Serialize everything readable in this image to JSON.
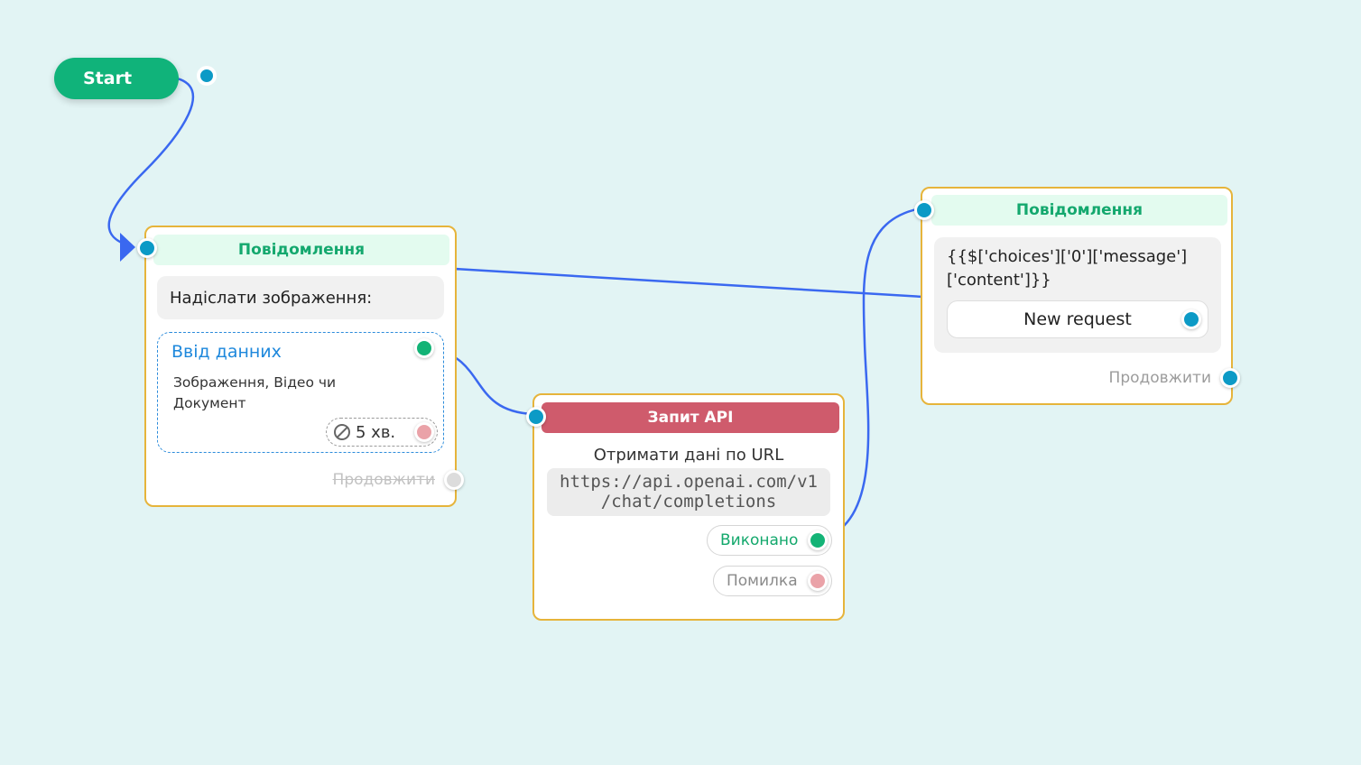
{
  "start": {
    "label": "Start"
  },
  "node_message_1": {
    "header": "Повідомлення",
    "text": "Надіслати зображення:",
    "input": {
      "title": "Ввід данних",
      "description": "Зображення, Відео чи Документ",
      "timeout": "5 хв."
    },
    "continue_label": "Продовжити"
  },
  "node_api": {
    "header": "Запит API",
    "subtitle": "Отримати дані по URL",
    "url_line1": "https://api.openai.com/v1",
    "url_line2": "/chat/completions",
    "success_label": "Виконано",
    "error_label": "Помилка"
  },
  "node_message_2": {
    "header": "Повідомлення",
    "text_line1": "{{$['choices']['0']['message']",
    "text_line2": "['content']}}",
    "button_label": "New request",
    "continue_label": "Продовжити"
  },
  "colors": {
    "canvas": "#e2f4f4",
    "connector": "#3a68f0",
    "start": "#10b37a",
    "card_border": "#e6b43b",
    "api_header": "#cf5b6c",
    "port_blue": "#0c9ac6",
    "port_green": "#13b376",
    "port_pink": "#eaa2a8"
  }
}
